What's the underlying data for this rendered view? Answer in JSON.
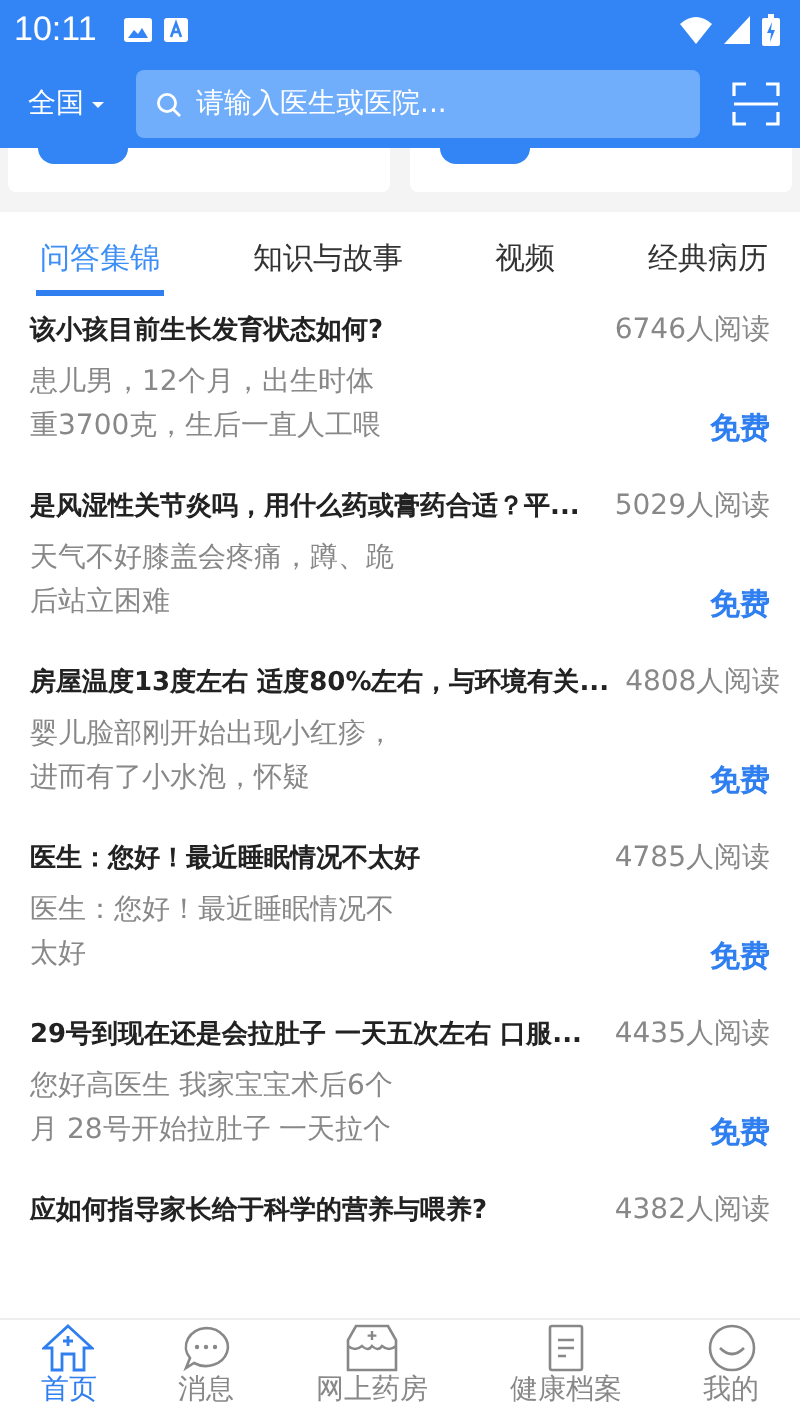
{
  "status_bar": {
    "time": "10:11"
  },
  "header": {
    "region": "全国",
    "search": {
      "placeholder": "请输入医生或医院..."
    }
  },
  "tabs": [
    {
      "label": "问答集锦",
      "selected": true
    },
    {
      "label": "知识与故事",
      "selected": false
    },
    {
      "label": "视频",
      "selected": false
    },
    {
      "label": "经典病历",
      "selected": false
    }
  ],
  "questions": [
    {
      "title": "该小孩目前生长发育状态如何?",
      "reads": "6746人阅读",
      "desc": "患儿男，12个月，出生时体重3700克，生后一直人工喂",
      "price": "免费"
    },
    {
      "title": "是风湿性关节炎吗，用什么药或膏药合适？平...",
      "reads": "5029人阅读",
      "desc": "天气不好膝盖会疼痛，蹲、跪后站立困难",
      "price": "免费"
    },
    {
      "title": "房屋温度13度左右 适度80%左右，与环境有关...",
      "reads": "4808人阅读",
      "desc": " 婴儿脸部刚开始出现小红疹，进而有了小水泡，怀疑",
      "price": "免费"
    },
    {
      "title": "医生：您好！最近睡眠情况不太好",
      "reads": "4785人阅读",
      "desc": "医生：您好！最近睡眠情况不太好",
      "price": "免费"
    },
    {
      "title": " 29号到现在还是会拉肚子 一天五次左右 口服...",
      "reads": "4435人阅读",
      "desc": "您好高医生 我家宝宝术后6个月 28号开始拉肚子 一天拉个",
      "price": "免费"
    },
    {
      "title": "应如何指导家长给于科学的营养与喂养?",
      "reads": "4382人阅读"
    }
  ],
  "bottom_nav": [
    {
      "label": "首页",
      "kind": "home",
      "selected": true
    },
    {
      "label": "消息",
      "kind": "chat",
      "selected": false
    },
    {
      "label": "网上药房",
      "kind": "shop",
      "selected": false
    },
    {
      "label": "健康档案",
      "kind": "doc",
      "selected": false
    },
    {
      "label": "我的",
      "kind": "me",
      "selected": false
    }
  ]
}
